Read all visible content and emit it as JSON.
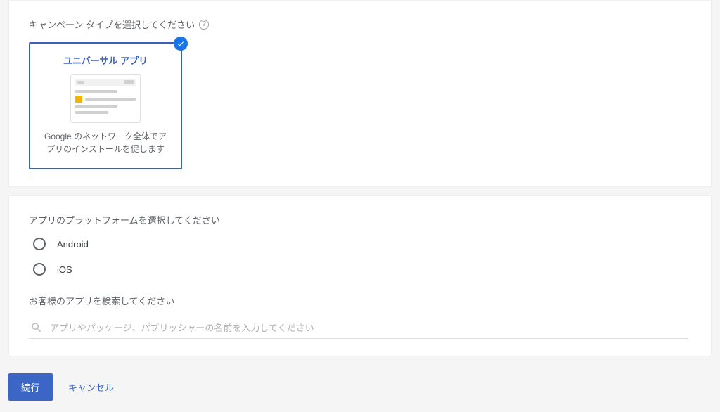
{
  "campaign_type_section": {
    "label": "キャンペーン タイプを選択してください",
    "card": {
      "title": "ユニバーサル アプリ",
      "description": "Google のネットワーク全体でアプリのインストールを促します"
    }
  },
  "platform_section": {
    "label": "アプリのプラットフォームを選択してください",
    "options": [
      {
        "label": "Android"
      },
      {
        "label": "iOS"
      }
    ],
    "search_label": "お客様のアプリを検索してください",
    "search_placeholder": "アプリやパッケージ、パブリッシャーの名前を入力してください"
  },
  "footer": {
    "continue": "続行",
    "cancel": "キャンセル"
  }
}
